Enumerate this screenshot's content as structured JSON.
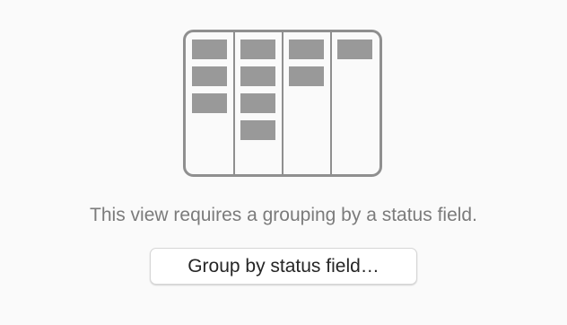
{
  "empty_state": {
    "message": "This view requires a grouping by a status field.",
    "action_label": "Group by status field…",
    "illustration_icon": "kanban-board-icon",
    "board_columns": [
      {
        "card_count": 3
      },
      {
        "card_count": 4
      },
      {
        "card_count": 2
      },
      {
        "card_count": 1
      }
    ]
  },
  "colors": {
    "background": "#fafafa",
    "illustration_stroke": "#8f8f8f",
    "card_fill": "#999999",
    "message_text": "#7b7b7b",
    "button_text": "#262626"
  }
}
